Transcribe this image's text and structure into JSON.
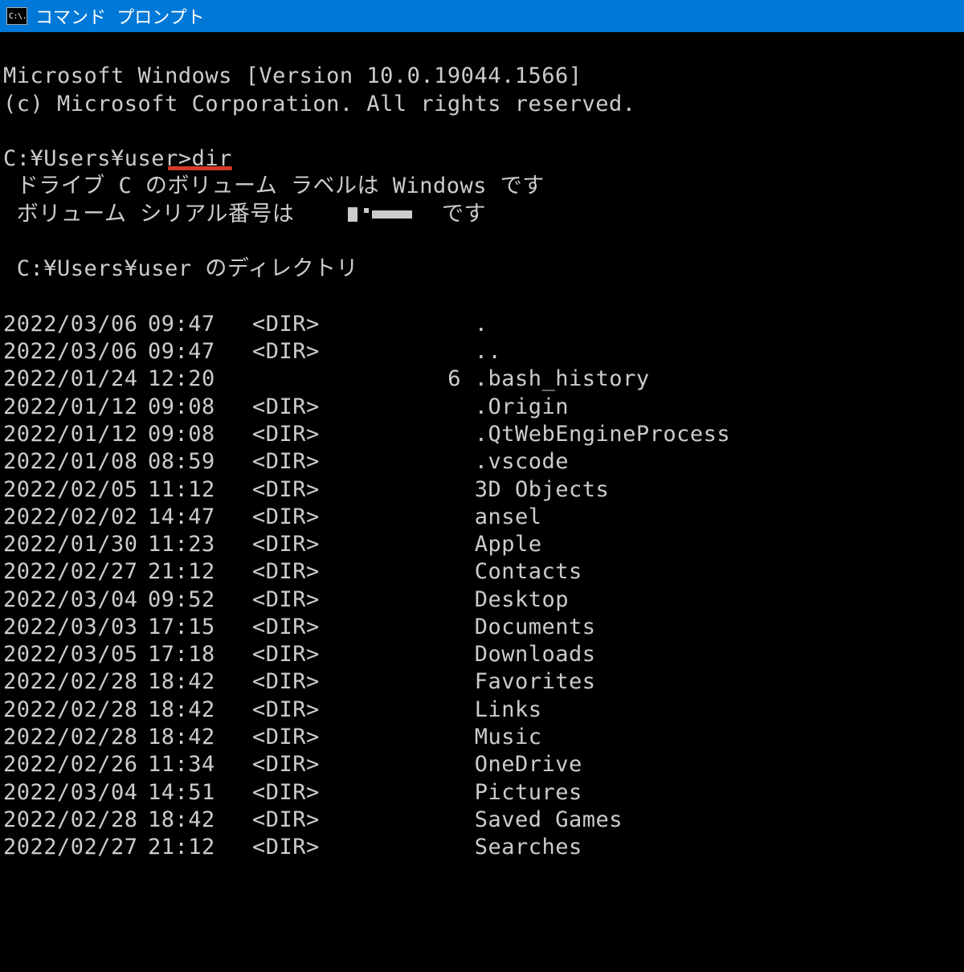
{
  "window": {
    "icon_label": "C:\\.",
    "title": "コマンド プロンプト"
  },
  "banner": {
    "line1": "Microsoft Windows [Version 10.0.19044.1566]",
    "line2": "(c) Microsoft Corporation. All rights reserved."
  },
  "prompt": {
    "path": "C:¥Users¥user>",
    "command": "dir"
  },
  "dir_output": {
    "volume_line": " ドライブ C のボリューム ラベルは Windows です",
    "serial_prefix": " ボリューム シリアル番号は ",
    "serial_suffix": " です",
    "path_line": " C:¥Users¥user のディレクトリ",
    "entries": [
      {
        "date": "2022/03/06",
        "time": "09:47",
        "type": "<DIR>",
        "size": "",
        "name": "."
      },
      {
        "date": "2022/03/06",
        "time": "09:47",
        "type": "<DIR>",
        "size": "",
        "name": ".."
      },
      {
        "date": "2022/01/24",
        "time": "12:20",
        "type": "",
        "size": "6",
        "name": ".bash_history"
      },
      {
        "date": "2022/01/12",
        "time": "09:08",
        "type": "<DIR>",
        "size": "",
        "name": ".Origin"
      },
      {
        "date": "2022/01/12",
        "time": "09:08",
        "type": "<DIR>",
        "size": "",
        "name": ".QtWebEngineProcess"
      },
      {
        "date": "2022/01/08",
        "time": "08:59",
        "type": "<DIR>",
        "size": "",
        "name": ".vscode"
      },
      {
        "date": "2022/02/05",
        "time": "11:12",
        "type": "<DIR>",
        "size": "",
        "name": "3D Objects"
      },
      {
        "date": "2022/02/02",
        "time": "14:47",
        "type": "<DIR>",
        "size": "",
        "name": "ansel"
      },
      {
        "date": "2022/01/30",
        "time": "11:23",
        "type": "<DIR>",
        "size": "",
        "name": "Apple"
      },
      {
        "date": "2022/02/27",
        "time": "21:12",
        "type": "<DIR>",
        "size": "",
        "name": "Contacts"
      },
      {
        "date": "2022/03/04",
        "time": "09:52",
        "type": "<DIR>",
        "size": "",
        "name": "Desktop"
      },
      {
        "date": "2022/03/03",
        "time": "17:15",
        "type": "<DIR>",
        "size": "",
        "name": "Documents"
      },
      {
        "date": "2022/03/05",
        "time": "17:18",
        "type": "<DIR>",
        "size": "",
        "name": "Downloads"
      },
      {
        "date": "2022/02/28",
        "time": "18:42",
        "type": "<DIR>",
        "size": "",
        "name": "Favorites"
      },
      {
        "date": "2022/02/28",
        "time": "18:42",
        "type": "<DIR>",
        "size": "",
        "name": "Links"
      },
      {
        "date": "2022/02/28",
        "time": "18:42",
        "type": "<DIR>",
        "size": "",
        "name": "Music"
      },
      {
        "date": "2022/02/26",
        "time": "11:34",
        "type": "<DIR>",
        "size": "",
        "name": "OneDrive"
      },
      {
        "date": "2022/03/04",
        "time": "14:51",
        "type": "<DIR>",
        "size": "",
        "name": "Pictures"
      },
      {
        "date": "2022/02/28",
        "time": "18:42",
        "type": "<DIR>",
        "size": "",
        "name": "Saved Games"
      },
      {
        "date": "2022/02/27",
        "time": "21:12",
        "type": "<DIR>",
        "size": "",
        "name": "Searches"
      }
    ]
  }
}
